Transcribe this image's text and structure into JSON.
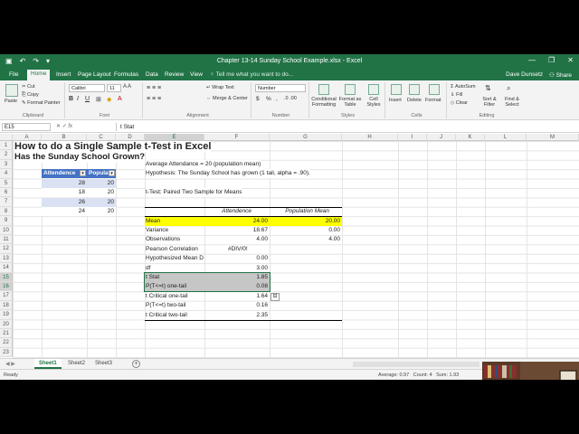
{
  "window": {
    "title": "Chapter 13-14 Sunday School Example.xlsx - Excel",
    "quick_access": [
      "save-icon",
      "undo-icon",
      "redo-icon",
      "customize-icon"
    ],
    "controls": [
      "—",
      "❐",
      "✕"
    ]
  },
  "tabs": [
    {
      "label": "File",
      "active": false
    },
    {
      "label": "Home",
      "active": true
    },
    {
      "label": "Insert",
      "active": false
    },
    {
      "label": "Page Layout",
      "active": false
    },
    {
      "label": "Formulas",
      "active": false
    },
    {
      "label": "Data",
      "active": false
    },
    {
      "label": "Review",
      "active": false
    },
    {
      "label": "View",
      "active": false
    }
  ],
  "tell_me": "Tell me what you want to do...",
  "user": "Dave Dunsetz",
  "share": "Share",
  "ribbon": {
    "clipboard": {
      "paste": "Paste",
      "cut": "Cut",
      "copy": "Copy",
      "format_painter": "Format Painter",
      "label": "Clipboard"
    },
    "font": {
      "name": "Calibri",
      "size": "11",
      "label": "Font",
      "bold": "B",
      "italic": "I",
      "underline": "U"
    },
    "alignment": {
      "wrap": "Wrap Text",
      "merge": "Merge & Center",
      "label": "Alignment"
    },
    "number": {
      "format": "Number",
      "label": "Number",
      "currency": "$",
      "percent": "%",
      "comma": ","
    },
    "styles": {
      "conditional": "Conditional Formatting",
      "table": "Format as Table",
      "cell": "Cell Styles",
      "label": "Styles"
    },
    "cells": {
      "insert": "Insert",
      "delete": "Delete",
      "format": "Format",
      "label": "Cells"
    },
    "editing": {
      "autosum": "AutoSum",
      "fill": "Fill",
      "clear": "Clear",
      "sort": "Sort & Filter",
      "find": "Find & Select",
      "label": "Editing"
    }
  },
  "formula_bar": {
    "name_box": "E15",
    "fx": "fx",
    "value": "t Stat"
  },
  "columns": [
    "A",
    "B",
    "C",
    "D",
    "E",
    "F",
    "G",
    "H",
    "I",
    "J",
    "K",
    "L",
    "M"
  ],
  "rows": [
    "1",
    "2",
    "3",
    "4",
    "5",
    "6",
    "7",
    "8",
    "9",
    "10",
    "11",
    "12",
    "13",
    "14",
    "15",
    "16",
    "17",
    "18",
    "19",
    "20",
    "21",
    "22",
    "23"
  ],
  "sheet": {
    "title": "How to do a Single Sample t-Test in Excel",
    "subtitle": "Has the Sunday School Grown?",
    "table_headers": [
      "Attendence",
      "Populatio"
    ],
    "table_rows": [
      [
        "28",
        "20"
      ],
      [
        "18",
        "20"
      ],
      [
        "26",
        "20"
      ],
      [
        "24",
        "20"
      ]
    ],
    "note1": "Average Attendance = 20 (population mean)",
    "note2": "Hypothesis: The Sunday School has grown (1 tail, alpha = .90).",
    "ttest_title": "t-Test: Paired Two Sample for Means",
    "col_attendence": "Attendence",
    "col_population": "Population Mean",
    "stats": [
      {
        "label": "Mean",
        "a": "24.00",
        "b": "20.00"
      },
      {
        "label": "Variance",
        "a": "18.67",
        "b": "0.00"
      },
      {
        "label": "Observations",
        "a": "4.00",
        "b": "4.00"
      },
      {
        "label": "Pearson Correlation",
        "a": "#DIV/0!",
        "b": ""
      },
      {
        "label": "Hypothesized Mean D",
        "a": "0.00",
        "b": ""
      },
      {
        "label": "df",
        "a": "3.00",
        "b": ""
      },
      {
        "label": "t Stat",
        "a": "1.85",
        "b": ""
      },
      {
        "label": "P(T<=t) one-tail",
        "a": "0.08",
        "b": ""
      },
      {
        "label": "t Critical one-tail",
        "a": "1.64",
        "b": ""
      },
      {
        "label": "P(T<=t) two-tail",
        "a": "0.16",
        "b": ""
      },
      {
        "label": "t Critical two-tail",
        "a": "2.35",
        "b": ""
      }
    ]
  },
  "sheet_tabs": [
    {
      "label": "Sheet1",
      "active": true
    },
    {
      "label": "Sheet2",
      "active": false
    },
    {
      "label": "Sheet3",
      "active": false
    }
  ],
  "status": {
    "ready": "Ready",
    "average": "Average: 0.97",
    "count": "Count: 4",
    "sum": "Sum: 1.93"
  },
  "colors": {
    "excel_green": "#217346",
    "table_blue": "#4472c4",
    "highlight": "#ffff00"
  }
}
